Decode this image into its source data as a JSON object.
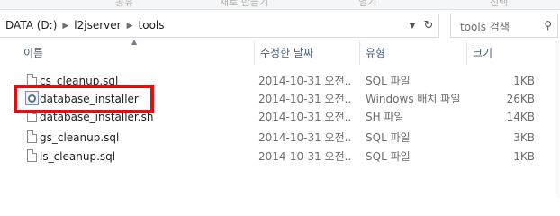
{
  "ribbon": {
    "labels": [
      "공유",
      "새로 만들기",
      "열기",
      "선택"
    ]
  },
  "address": {
    "crumbs": [
      "DATA (D:)",
      "l2jserver",
      "tools"
    ],
    "dropdown_icon": "chevron-down-icon",
    "refresh_icon": "refresh-icon"
  },
  "search": {
    "placeholder": "tools 검색",
    "icon": "search-icon"
  },
  "columns": {
    "name": "이름",
    "date": "수정한 날짜",
    "type": "유형",
    "size": "크기"
  },
  "files": [
    {
      "name": "cs_cleanup.sql",
      "date": "2014-10-31 오전...",
      "type": "SQL 파일",
      "size": "1KB",
      "icon": "file-icon"
    },
    {
      "name": "database_installer",
      "date": "2014-10-31 오전...",
      "type": "Windows 배치 파일",
      "size": "26KB",
      "icon": "batch-file-icon"
    },
    {
      "name": "database_installer.sh",
      "date": "2014-10-31 오전...",
      "type": "SH 파일",
      "size": "14KB",
      "icon": "file-icon"
    },
    {
      "name": "gs_cleanup.sql",
      "date": "2014-10-31 오전...",
      "type": "SQL 파일",
      "size": "3KB",
      "icon": "file-icon"
    },
    {
      "name": "ls_cleanup.sql",
      "date": "2014-10-31 오전...",
      "type": "SQL 파일",
      "size": "1KB",
      "icon": "file-icon"
    }
  ],
  "colors": {
    "highlight": "#e01010",
    "header_text": "#4c607a"
  }
}
